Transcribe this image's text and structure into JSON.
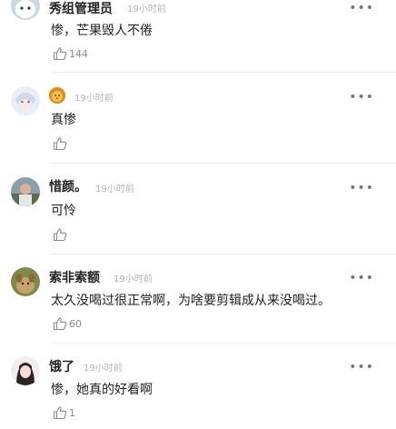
{
  "comments": [
    {
      "username": "秀组管理员",
      "time": "19小时前",
      "text": "惨，芒果毁人不倦",
      "likes": "144",
      "avatar_icon": "avatar-white-cat"
    },
    {
      "username": "",
      "time": "19小时前",
      "text": "真惨",
      "likes": "",
      "avatar_icon": "avatar-anime-girl",
      "name_badge_icon": "lion-emoji"
    },
    {
      "username": "惜颜。",
      "time": "19小时前",
      "text": "可怜",
      "likes": "",
      "avatar_icon": "avatar-photo"
    },
    {
      "username": "索非索额",
      "time": "19小时前",
      "text": "太久没喝过很正常啊，为啥要剪辑成从来没喝过。",
      "likes": "60",
      "avatar_icon": "avatar-dog"
    },
    {
      "username": "饿了",
      "time": "19小时前",
      "text": "惨，她真的好看啊",
      "likes": "1",
      "avatar_icon": "avatar-girl"
    }
  ],
  "more_label": "•••",
  "colors": {
    "text": "#222222",
    "muted": "#b3b3b3",
    "divider": "#ececec"
  }
}
